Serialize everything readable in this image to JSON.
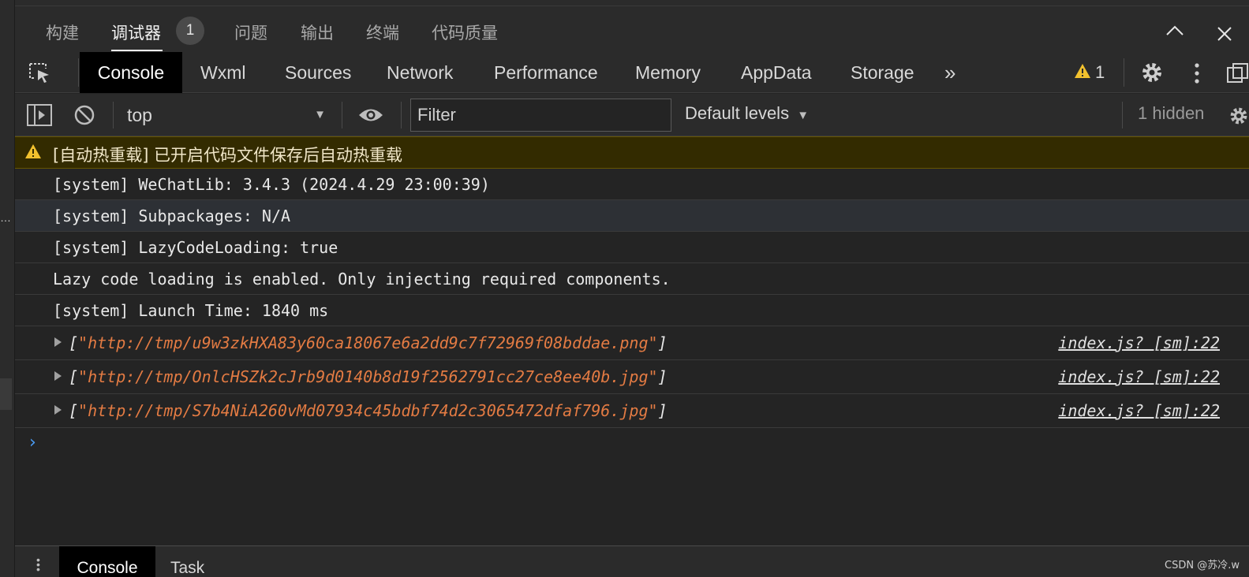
{
  "panel_tabs": [
    {
      "label": "构建"
    },
    {
      "label": "调试器",
      "active": true,
      "badge": "1"
    },
    {
      "label": "问题"
    },
    {
      "label": "输出"
    },
    {
      "label": "终端"
    },
    {
      "label": "代码质量"
    }
  ],
  "devtools_tabs": [
    {
      "label": "Console",
      "active": true
    },
    {
      "label": "Wxml"
    },
    {
      "label": "Sources"
    },
    {
      "label": "Network"
    },
    {
      "label": "Performance"
    },
    {
      "label": "Memory"
    },
    {
      "label": "AppData"
    },
    {
      "label": "Storage"
    },
    {
      "label": "»"
    }
  ],
  "warning_count": "1",
  "toolbar": {
    "context": "top",
    "filter_placeholder": "Filter",
    "levels_label": "Default levels",
    "hidden_label": "1 hidden"
  },
  "messages": {
    "warning": "[自动热重载] 已开启代码文件保存后自动热重载",
    "lines": [
      "[system] WeChatLib: 3.4.3 (2024.4.29 23:00:39)",
      "[system] Subpackages: N/A",
      "[system] LazyCodeLoading: true",
      "Lazy code loading is enabled. Only injecting required components.",
      "[system] Launch Time: 1840 ms"
    ],
    "arrays": [
      {
        "url": "\"http://tmp/u9w3zkHXA83y60ca18067e6a2dd9c7f72969f08bddae.png\"",
        "source": "index.js? [sm]:22"
      },
      {
        "url": "\"http://tmp/OnlcHSZk2cJrb9d0140b8d19f2562791cc27ce8ee40b.jpg\"",
        "source": "index.js? [sm]:22"
      },
      {
        "url": "\"http://tmp/S7b4NiA260vMd07934c45bdbf74d2c3065472dfaf796.jpg\"",
        "source": "index.js? [sm]:22"
      }
    ]
  },
  "drawer_tabs": [
    {
      "label": "Console",
      "active": true
    },
    {
      "label": "Task"
    }
  ],
  "watermark": "CSDN @苏冷.w",
  "colors": {
    "background": "#242424",
    "panel": "#2b2b2b",
    "warning_bg": "#332b00",
    "warning_icon": "#f2c12e",
    "url": "#e37b43",
    "prompt": "#4a9cf5"
  }
}
